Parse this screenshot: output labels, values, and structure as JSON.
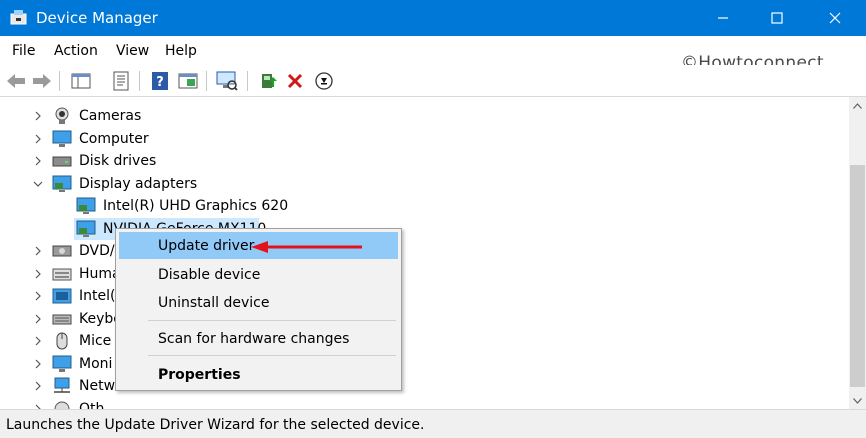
{
  "window": {
    "title": "Device Manager",
    "min_icon": "minimize-icon",
    "max_icon": "maximize-icon",
    "close_icon": "close-icon"
  },
  "menubar": {
    "items": [
      "File",
      "Action",
      "View",
      "Help"
    ]
  },
  "watermark": "©Howtoconnect",
  "toolbar": {
    "icons": [
      "back-arrow-icon",
      "forward-arrow-icon",
      "show-hide-console-tree-icon",
      "properties-icon",
      "help-icon",
      "details-view-icon",
      "scan-hardware-icon",
      "update-driver-icon",
      "uninstall-device-icon",
      "disable-device-icon"
    ]
  },
  "tree": {
    "items": [
      {
        "label": "Cameras",
        "icon": "camera-icon",
        "expanded": false
      },
      {
        "label": "Computer",
        "icon": "computer-icon",
        "expanded": false
      },
      {
        "label": "Disk drives",
        "icon": "disk-drive-icon",
        "expanded": false
      },
      {
        "label": "Display adapters",
        "icon": "display-adapter-icon",
        "expanded": true
      },
      {
        "label": "Intel(R) UHD Graphics 620",
        "icon": "display-adapter-icon",
        "child": true
      },
      {
        "label": "NVIDIA GeForce MX110",
        "icon": "display-adapter-icon",
        "child": true,
        "selected": true
      },
      {
        "label": "DVD/",
        "icon": "dvd-drive-icon",
        "expanded": false
      },
      {
        "label": "Huma",
        "icon": "hid-icon",
        "expanded": false
      },
      {
        "label": "Intel(",
        "icon": "intel-icon",
        "expanded": false
      },
      {
        "label": "Keybo",
        "icon": "keyboard-icon",
        "expanded": false
      },
      {
        "label": "Mice",
        "icon": "mouse-icon",
        "expanded": false
      },
      {
        "label": "Moni",
        "icon": "monitor-icon",
        "expanded": false
      },
      {
        "label": "Netw",
        "icon": "network-adapter-icon",
        "expanded": false
      },
      {
        "label": "Oth",
        "icon": "other-devices-icon",
        "expanded": false
      }
    ]
  },
  "context_menu": {
    "items": [
      {
        "label": "Update driver",
        "highlighted": true
      },
      {
        "label": "Disable device"
      },
      {
        "label": "Uninstall device"
      },
      {
        "label": "Scan for hardware changes"
      },
      {
        "label": "Properties",
        "bold": true
      }
    ]
  },
  "colors": {
    "titlebar": "#0078d7",
    "highlight": "#91c9f7",
    "selection": "#cce8ff",
    "arrow": "#e3131b"
  },
  "statusbar": {
    "text": "Launches the Update Driver Wizard for the selected device."
  }
}
